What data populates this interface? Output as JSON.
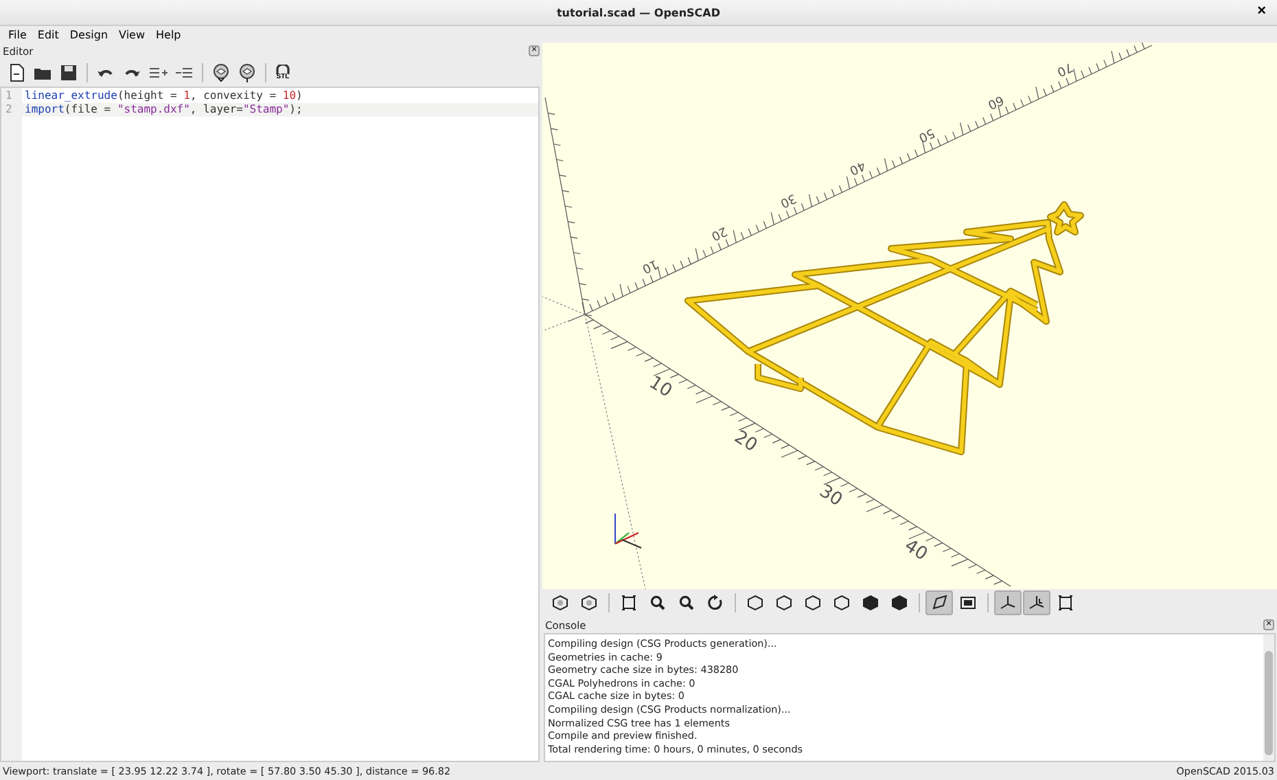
{
  "window": {
    "title": "tutorial.scad — OpenSCAD",
    "close": "×"
  },
  "menu": [
    {
      "label": "File"
    },
    {
      "label": "Edit"
    },
    {
      "label": "Design"
    },
    {
      "label": "View"
    },
    {
      "label": "Help"
    }
  ],
  "editor": {
    "title": "Editor",
    "close": "×",
    "toolbar": [
      {
        "kind": "new"
      },
      {
        "kind": "open"
      },
      {
        "kind": "save"
      },
      {
        "kind": "sep"
      },
      {
        "kind": "undo"
      },
      {
        "kind": "redo"
      },
      {
        "kind": "indent"
      },
      {
        "kind": "unindent"
      },
      {
        "kind": "sep"
      },
      {
        "kind": "preview"
      },
      {
        "kind": "render"
      },
      {
        "kind": "sep"
      },
      {
        "kind": "stl",
        "label": "STL"
      }
    ],
    "lines": [
      {
        "number": "1",
        "current": false,
        "tokens": [
          {
            "kind": "keyword",
            "text": "linear_extrude"
          },
          {
            "kind": "plain",
            "text": "(height = "
          },
          {
            "kind": "number",
            "text": "1"
          },
          {
            "kind": "plain",
            "text": ", convexity = "
          },
          {
            "kind": "number",
            "text": "10"
          },
          {
            "kind": "plain",
            "text": ")"
          }
        ]
      },
      {
        "number": "2",
        "current": true,
        "tokens": [
          {
            "kind": "keyword",
            "text": "import"
          },
          {
            "kind": "plain",
            "text": "(file = "
          },
          {
            "kind": "string",
            "text": "\"stamp.dxf\""
          },
          {
            "kind": "plain",
            "text": ", layer="
          },
          {
            "kind": "string",
            "text": "\"Stamp\""
          },
          {
            "kind": "plain",
            "text": ");"
          }
        ]
      }
    ]
  },
  "viewport": {
    "front_labels": [
      "10",
      "20",
      "30",
      "40"
    ],
    "back_labels": [
      "10",
      "20",
      "30",
      "40",
      "50",
      "60",
      "70"
    ]
  },
  "view_toolbar": [
    {
      "kind": "preview",
      "on": false
    },
    {
      "kind": "render",
      "on": false
    },
    {
      "kind": "sep"
    },
    {
      "kind": "viewall",
      "on": false
    },
    {
      "kind": "zoomin",
      "on": false
    },
    {
      "kind": "zoomout",
      "on": false
    },
    {
      "kind": "reset",
      "on": false
    },
    {
      "kind": "sep"
    },
    {
      "kind": "right",
      "on": false
    },
    {
      "kind": "top",
      "on": false
    },
    {
      "kind": "bottom",
      "on": false
    },
    {
      "kind": "left",
      "on": false
    },
    {
      "kind": "front",
      "on": false
    },
    {
      "kind": "back",
      "on": false
    },
    {
      "kind": "sep"
    },
    {
      "kind": "perspective",
      "on": true
    },
    {
      "kind": "ortho",
      "on": false
    },
    {
      "kind": "sep"
    },
    {
      "kind": "axes",
      "on": true
    },
    {
      "kind": "scale",
      "on": true
    },
    {
      "kind": "edges",
      "on": false
    }
  ],
  "console": {
    "title": "Console",
    "close": "×",
    "lines": [
      "Compiling design (CSG Products generation)...",
      "Geometries in cache: 9",
      "Geometry cache size in bytes: 438280",
      "CGAL Polyhedrons in cache: 0",
      "CGAL cache size in bytes: 0",
      "Compiling design (CSG Products normalization)...",
      "Normalized CSG tree has 1 elements",
      "Compile and preview finished.",
      "Total rendering time: 0 hours, 0 minutes, 0 seconds"
    ]
  },
  "status_bar": {
    "viewport": "Viewport: translate = [ 23.95 12.22 3.74 ], rotate = [ 57.80 3.50 45.30 ], distance = 96.82",
    "version": "OpenSCAD 2015.03"
  }
}
